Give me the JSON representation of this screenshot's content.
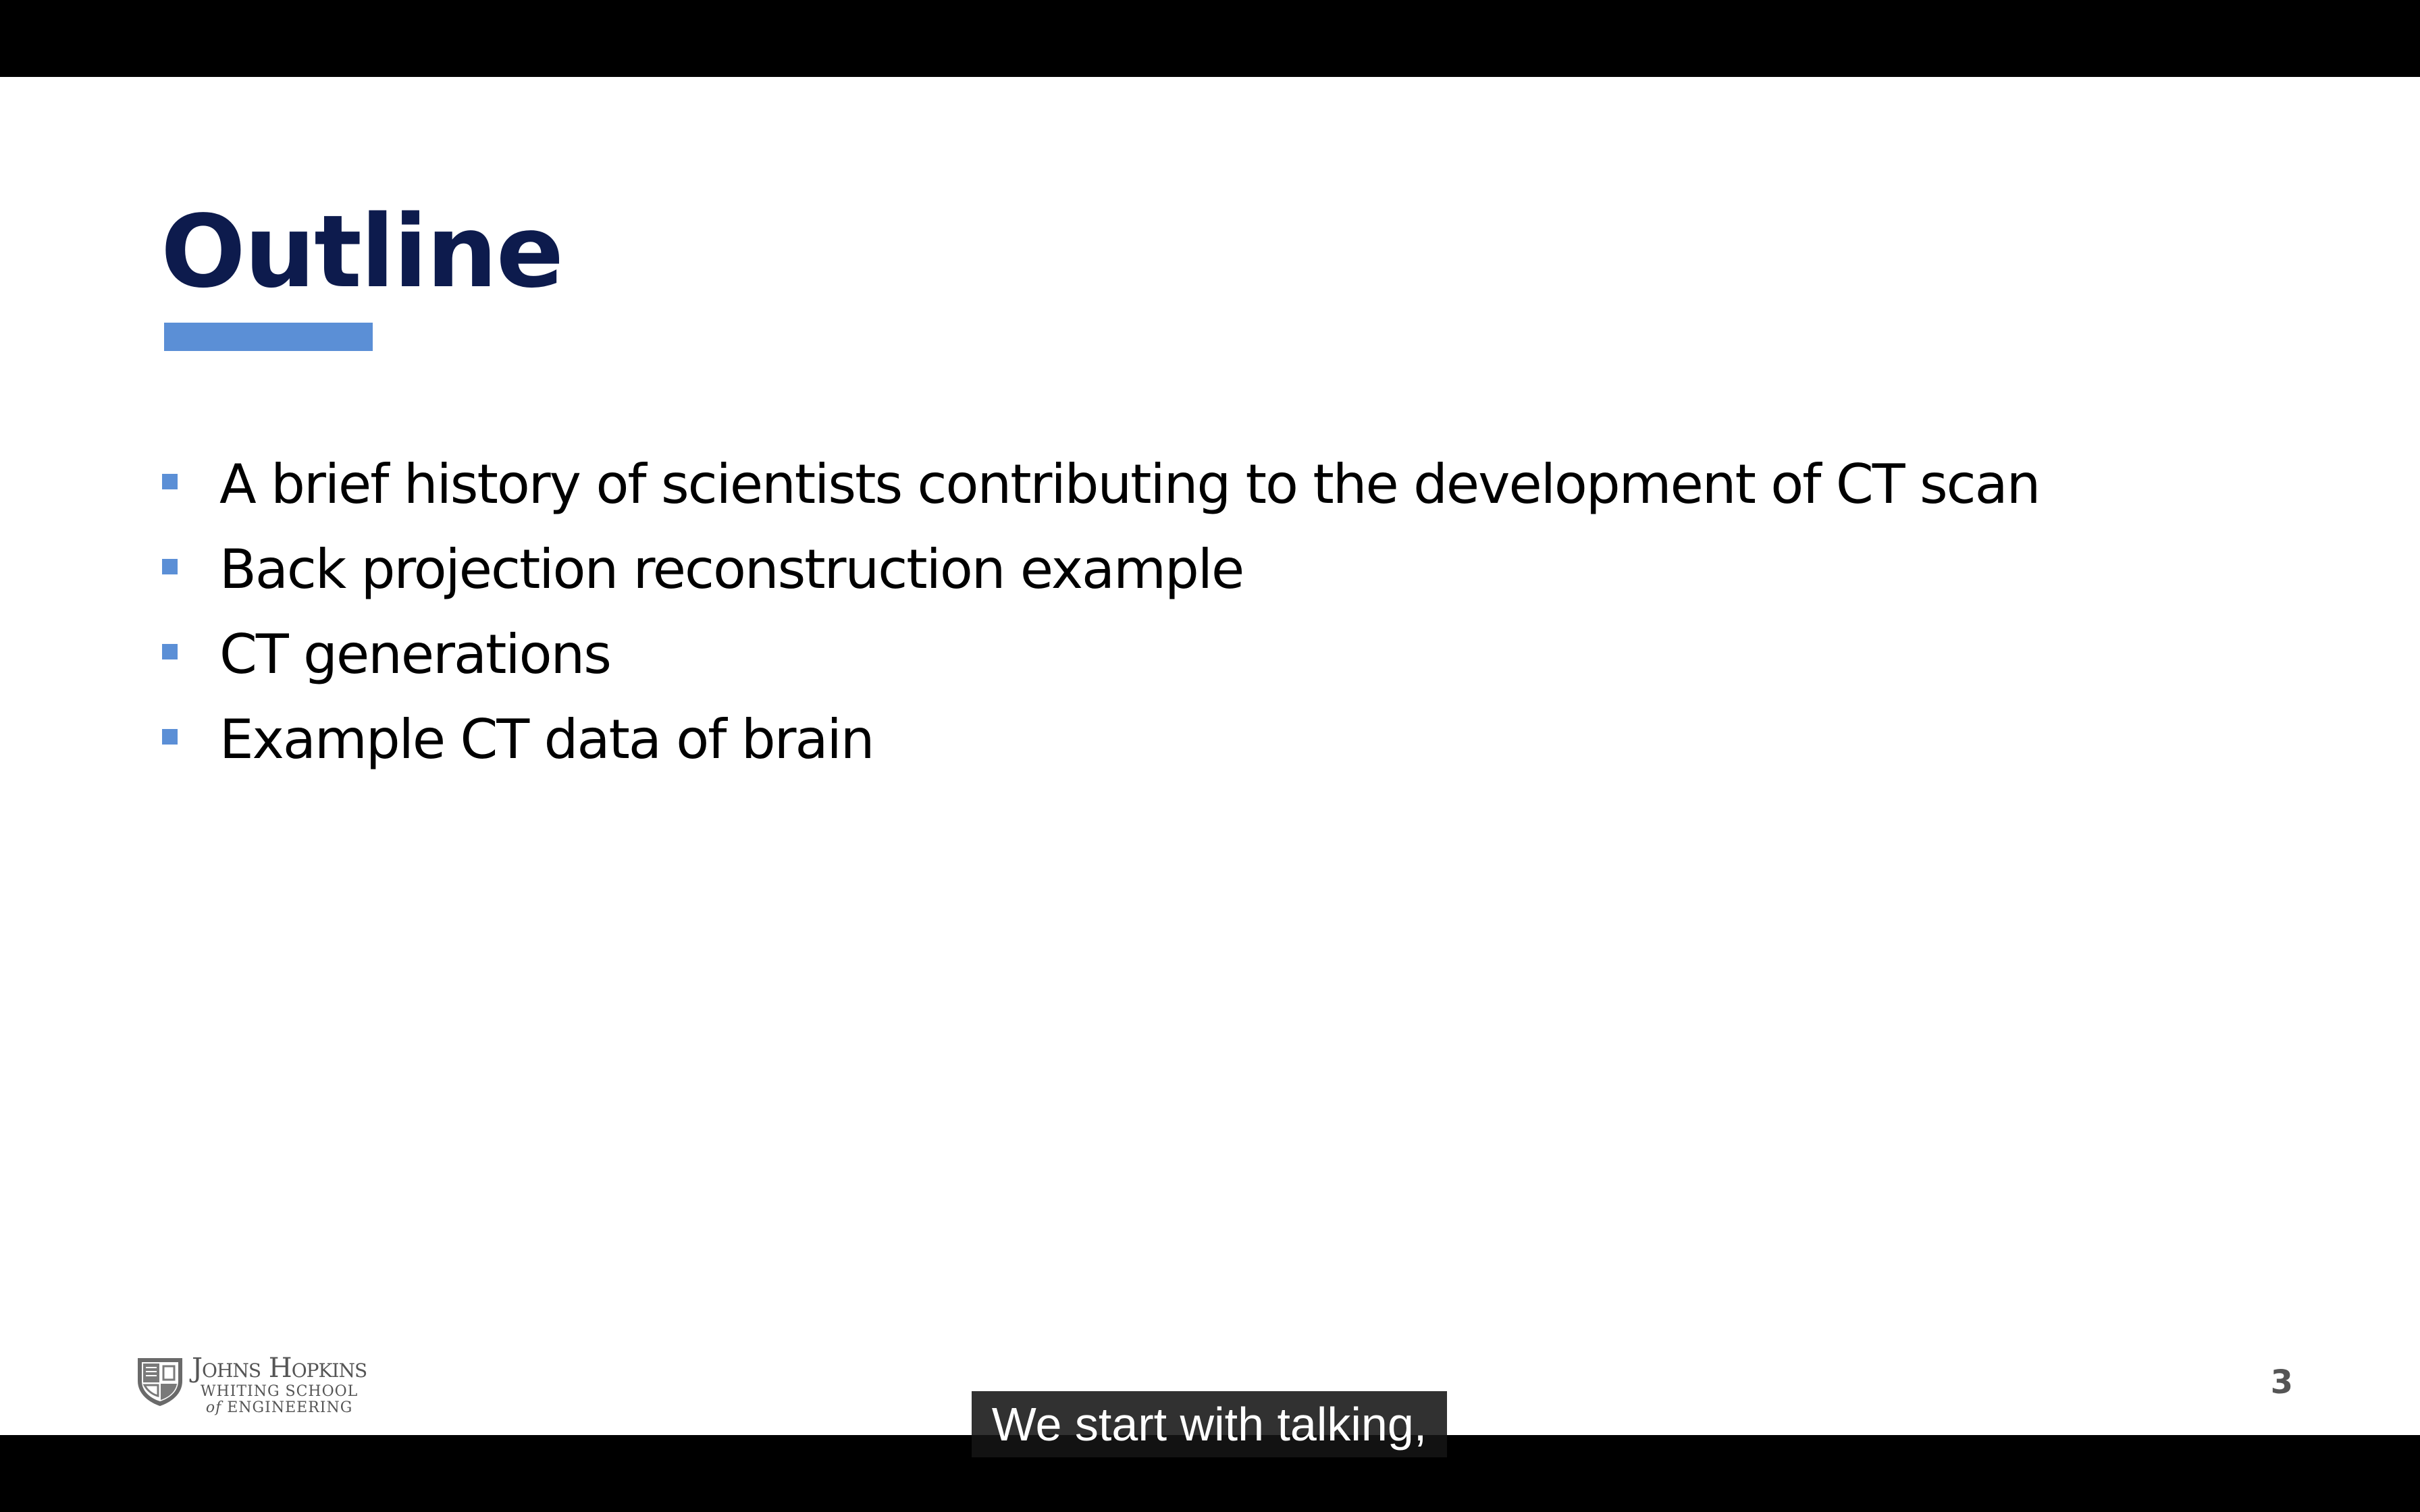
{
  "slide": {
    "title": "Outline",
    "bullets": [
      "A brief history of scientists contributing to the development of CT scan",
      "Back projection reconstruction example",
      "CT generations",
      "Example CT data of brain"
    ],
    "page_number": "3",
    "logo": {
      "icon": "university-shield-icon",
      "name": "Johns Hopkins",
      "line1": "WHITING SCHOOL",
      "line2_of": "of",
      "line2_rest": "ENGINEERING"
    }
  },
  "caption": {
    "text": "We start with talking,"
  },
  "colors": {
    "title": "#0d1b4d",
    "accent": "#5b8fd6",
    "background": "#ffffff",
    "letterbox": "#000000"
  }
}
